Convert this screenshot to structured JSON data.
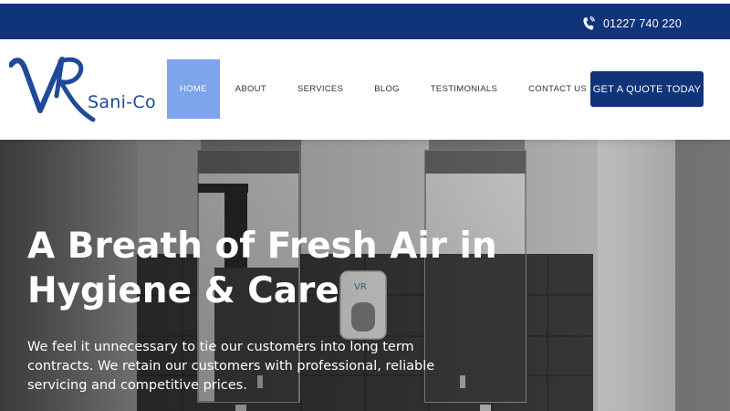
{
  "topbar": {
    "phone_icon": "phone-icon",
    "phone_number": "01227 740 220"
  },
  "header": {
    "logo": {
      "text": "Sani-Co",
      "mark": "VR"
    },
    "nav": [
      {
        "label": "HOME",
        "active": true
      },
      {
        "label": "ABOUT",
        "active": false
      },
      {
        "label": "SERVICES",
        "active": false
      },
      {
        "label": "BLOG",
        "active": false
      },
      {
        "label": "TESTIMONIALS",
        "active": false
      },
      {
        "label": "CONTACT US",
        "active": false
      }
    ],
    "cta_label": "GET A QUOTE TODAY"
  },
  "hero": {
    "title": "A Breath of Fresh Air in Hygiene & Care",
    "text": "We feel it unnecessary to tie our customers into long term contracts. We retain our customers with professional, reliable servicing and competitive prices."
  },
  "colors": {
    "brand_navy": "#11337a",
    "nav_active": "#7ea4ec",
    "logo_blue": "#1f4a9a"
  }
}
